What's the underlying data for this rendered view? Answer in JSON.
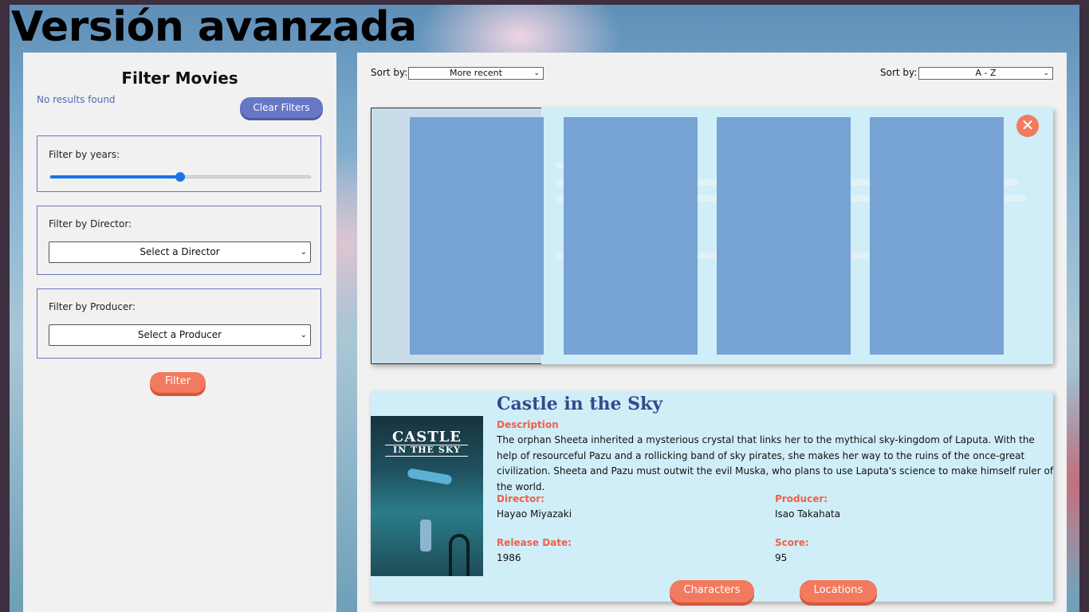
{
  "headline": "Versión avanzada",
  "sidebar": {
    "title": "Filter Movies",
    "no_results": "No results found",
    "clear_label": "Clear Filters",
    "years": {
      "label": "Filter by years:",
      "slider_value_fraction": 0.5
    },
    "director": {
      "label": "Filter by Director:",
      "selected": "Select a Director"
    },
    "producer": {
      "label": "Filter by Producer:",
      "selected": "Select a Producer"
    },
    "filter_label": "Filter"
  },
  "sort": {
    "left": {
      "label": "Sort by:",
      "selected": "More recent"
    },
    "right": {
      "label": "Sort by:",
      "selected": "A - Z"
    }
  },
  "modal": {
    "close_icon": "close-icon",
    "cards": [
      "character-card-1",
      "character-card-2",
      "character-card-3",
      "character-card-4"
    ]
  },
  "movie": {
    "title": "Castle in the Sky",
    "poster_title_line1": "CASTLE",
    "poster_title_line2": "IN THE SKY",
    "description_label": "Description",
    "description": "The orphan Sheeta inherited a mysterious crystal that links her to the mythical sky-kingdom of Laputa. With the help of resourceful Pazu and a rollicking band of sky pirates, she makes her way to the ruins of the once-great civilization. Sheeta and Pazu must outwit the evil Muska, who plans to use Laputa's science to make himself ruler of the world.",
    "director_label": "Director:",
    "director": "Hayao Miyazaki",
    "producer_label": "Producer:",
    "producer": "Isao Takahata",
    "release_label": "Release Date:",
    "release": "1986",
    "score_label": "Score:",
    "score": "95",
    "characters_label": "Characters",
    "locations_label": "Locations"
  },
  "colors": {
    "accent": "#f27a5e",
    "primary": "#6677c4",
    "card_bg": "#d0eef8",
    "title": "#344a8c",
    "label": "#f0604a"
  }
}
